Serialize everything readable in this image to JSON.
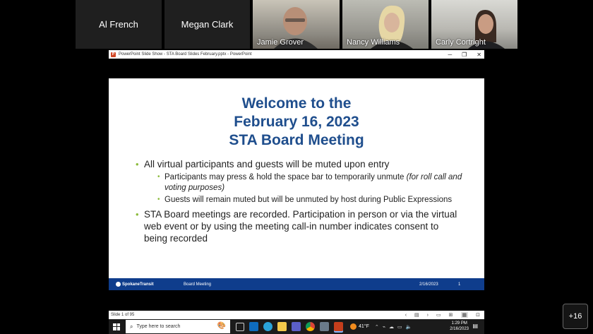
{
  "participants": [
    {
      "name": "Al French",
      "video": false
    },
    {
      "name": "Megan Clark",
      "video": false
    },
    {
      "name": "Jamie Grover",
      "video": true
    },
    {
      "name": "Nancy Williams",
      "video": true
    },
    {
      "name": "Carly Cortright",
      "video": true
    }
  ],
  "more_participants": "+16",
  "ppt": {
    "window_title": "PowerPoint Slide Show  -  STA Board Slides February.pptx - PowerPoint",
    "win_min": "─",
    "win_restore": "❐",
    "win_close": "✕",
    "status_slide": "Slide 1 of 95"
  },
  "slide": {
    "title_lines": [
      "Welcome to the",
      "February 16, 2023",
      "STA Board Meeting"
    ],
    "bullet1": "All virtual participants and guests will be muted upon entry",
    "sub1_text": "Participants may press & hold the space bar to temporarily unmute ",
    "sub1_italic": "(for roll call and voting purposes)",
    "sub2": "Guests will remain muted but will be unmuted by host during Public Expressions",
    "bullet2": "STA Board meetings are recorded. Participation in person or via the virtual web event or by using the meeting call-in number indicates consent to being recorded",
    "footer_logo": "SpokaneTransit",
    "footer_meeting": "Board Meeting",
    "footer_date": "2/16/2023",
    "footer_page": "1"
  },
  "taskbar": {
    "search_placeholder": "Type here to search",
    "weather_temp": "41°F",
    "time": "1:29 PM",
    "date": "2/16/2023"
  },
  "colors": {
    "title_blue": "#1f4e8d",
    "footer_blue": "#0f3d8c",
    "bullet_green": "#8cbb3c"
  }
}
